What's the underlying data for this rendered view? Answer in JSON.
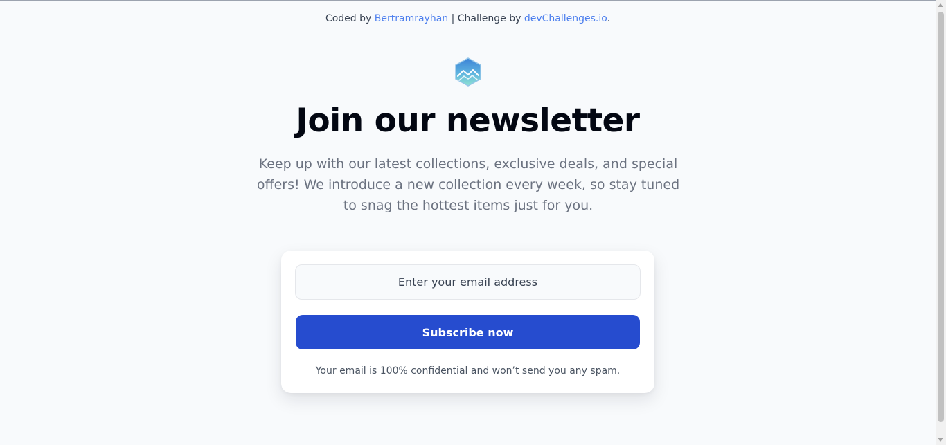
{
  "attribution": {
    "coded_by_prefix": "Coded by ",
    "author": "Bertramrayhan",
    "separator": " | Challenge by ",
    "challenge": "devChallenges.io",
    "suffix": "."
  },
  "header": {
    "logo_icon": "mountain-hexagon-icon",
    "title": "Join our newsletter",
    "subtitle": "Keep up with our latest collections, exclusive deals, and special offers! We introduce a new collection every week, so stay tuned to snag the hottest items just for you."
  },
  "form": {
    "email_placeholder": "Enter your email address",
    "email_value": "",
    "subscribe_label": "Subscribe now",
    "note": "Your email is 100% confidential and won’t send you any spam."
  },
  "colors": {
    "accent": "#264ccf",
    "link": "#4e80ee",
    "background": "#f8fafc"
  }
}
